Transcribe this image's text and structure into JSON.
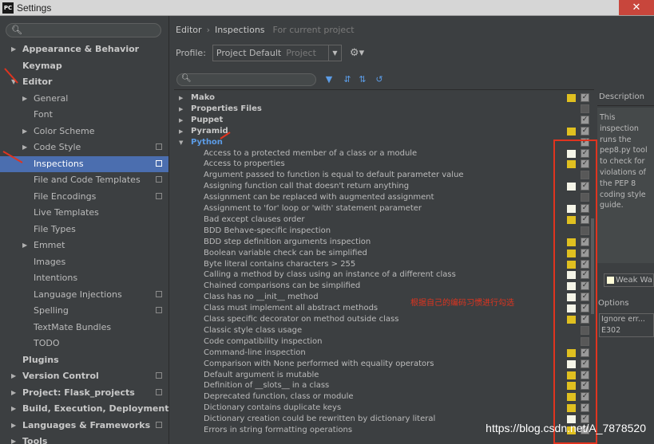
{
  "window": {
    "title": "Settings",
    "app_icon": "PC",
    "close_glyph": "✕"
  },
  "sidebar": {
    "search_placeholder": "",
    "items": [
      {
        "label": "Appearance & Behavior",
        "level": 0,
        "arrow": "▶",
        "bold": true
      },
      {
        "label": "Keymap",
        "level": 0,
        "arrow": "",
        "bold": true
      },
      {
        "label": "Editor",
        "level": 0,
        "arrow": "▼",
        "bold": true
      },
      {
        "label": "General",
        "level": 1,
        "arrow": "▶"
      },
      {
        "label": "Font",
        "level": 1,
        "arrow": ""
      },
      {
        "label": "Color Scheme",
        "level": 1,
        "arrow": "▶"
      },
      {
        "label": "Code Style",
        "level": 1,
        "arrow": "▶",
        "pin": true
      },
      {
        "label": "Inspections",
        "level": 1,
        "arrow": "",
        "pin": true,
        "selected": true
      },
      {
        "label": "File and Code Templates",
        "level": 1,
        "arrow": "",
        "pin": true
      },
      {
        "label": "File Encodings",
        "level": 1,
        "arrow": "",
        "pin": true
      },
      {
        "label": "Live Templates",
        "level": 1,
        "arrow": ""
      },
      {
        "label": "File Types",
        "level": 1,
        "arrow": ""
      },
      {
        "label": "Emmet",
        "level": 1,
        "arrow": "▶"
      },
      {
        "label": "Images",
        "level": 1,
        "arrow": ""
      },
      {
        "label": "Intentions",
        "level": 1,
        "arrow": ""
      },
      {
        "label": "Language Injections",
        "level": 1,
        "arrow": "",
        "pin": true
      },
      {
        "label": "Spelling",
        "level": 1,
        "arrow": "",
        "pin": true
      },
      {
        "label": "TextMate Bundles",
        "level": 1,
        "arrow": ""
      },
      {
        "label": "TODO",
        "level": 1,
        "arrow": ""
      },
      {
        "label": "Plugins",
        "level": 0,
        "arrow": "",
        "bold": true
      },
      {
        "label": "Version Control",
        "level": 0,
        "arrow": "▶",
        "bold": true,
        "pin": true
      },
      {
        "label": "Project: Flask_projects",
        "level": 0,
        "arrow": "▶",
        "bold": true,
        "pin": true
      },
      {
        "label": "Build, Execution, Deployment",
        "level": 0,
        "arrow": "▶",
        "bold": true
      },
      {
        "label": "Languages & Frameworks",
        "level": 0,
        "arrow": "▶",
        "bold": true,
        "pin": true
      },
      {
        "label": "Tools",
        "level": 0,
        "arrow": "▶",
        "bold": true
      }
    ]
  },
  "breadcrumb": {
    "part1": "Editor",
    "sep": "›",
    "part2": "Inspections",
    "note": "For current project"
  },
  "profile": {
    "label": "Profile:",
    "value": "Project Default",
    "scope": "Project",
    "dropdown_glyph": "▼",
    "gear_glyph": "⚙▾"
  },
  "inspections": {
    "groups_before": [
      {
        "label": "Mako",
        "sev": "#e0c020",
        "checked": true
      },
      {
        "label": "Properties Files",
        "sev": "",
        "checked": false
      },
      {
        "label": "Puppet",
        "sev": "",
        "checked": true
      },
      {
        "label": "Pyramid",
        "sev": "#e0c020",
        "checked": true
      }
    ],
    "python_label": "Python",
    "python_items": [
      {
        "label": "Access to a protected member of a class or a module",
        "sev": "#f5f5e8",
        "checked": true
      },
      {
        "label": "Access to properties",
        "sev": "#e0c020",
        "checked": true
      },
      {
        "label": "Argument passed to function is equal to default parameter value",
        "sev": "",
        "checked": false
      },
      {
        "label": "Assigning function call that doesn't return anything",
        "sev": "#f5f5e8",
        "checked": true
      },
      {
        "label": "Assignment can be replaced with augmented assignment",
        "sev": "",
        "checked": false
      },
      {
        "label": "Assignment to 'for' loop or 'with' statement parameter",
        "sev": "#f5f5e8",
        "checked": true
      },
      {
        "label": "Bad except clauses order",
        "sev": "#e0c020",
        "checked": true
      },
      {
        "label": "BDD Behave-specific inspection",
        "sev": "",
        "checked": false
      },
      {
        "label": "BDD step definition arguments inspection",
        "sev": "#e0c020",
        "checked": true
      },
      {
        "label": "Boolean variable check can be simplified",
        "sev": "#e0c020",
        "checked": true
      },
      {
        "label": "Byte literal contains characters > 255",
        "sev": "#e0c020",
        "checked": true
      },
      {
        "label": "Calling a method by class using an instance of a different class",
        "sev": "#f5f5e8",
        "checked": true
      },
      {
        "label": "Chained comparisons can be simplified",
        "sev": "#f5f5e8",
        "checked": true
      },
      {
        "label": "Class has no __init__ method",
        "sev": "#f5f5e8",
        "checked": true
      },
      {
        "label": "Class must implement all abstract methods",
        "sev": "#f5f5e8",
        "checked": true
      },
      {
        "label": "Class specific decorator on method outside class",
        "sev": "#e0c020",
        "checked": true
      },
      {
        "label": "Classic style class usage",
        "sev": "",
        "checked": false
      },
      {
        "label": "Code compatibility inspection",
        "sev": "",
        "checked": false
      },
      {
        "label": "Command-line inspection",
        "sev": "#e0c020",
        "checked": true
      },
      {
        "label": "Comparison with None performed with equality operators",
        "sev": "#f5f5e8",
        "checked": true
      },
      {
        "label": "Default argument is mutable",
        "sev": "#e0c020",
        "checked": true
      },
      {
        "label": "Definition of __slots__ in a class",
        "sev": "#e0c020",
        "checked": true
      },
      {
        "label": "Deprecated function, class or module",
        "sev": "#e0c020",
        "checked": true
      },
      {
        "label": "Dictionary contains duplicate keys",
        "sev": "#e0c020",
        "checked": true
      },
      {
        "label": "Dictionary creation could be rewritten by dictionary literal",
        "sev": "#f5f5e8",
        "checked": true
      },
      {
        "label": "Errors in string formatting operations",
        "sev": "#e0c020",
        "checked": true
      }
    ]
  },
  "description": {
    "header": "Description",
    "lines": [
      "This",
      "inspection",
      "runs the",
      "pep8.py tool",
      "to check for",
      "violations of",
      "the PEP 8",
      "coding style",
      "guide."
    ],
    "severity_value": "Weak Wa",
    "options_label": "Options",
    "options": [
      "Ignore err...",
      "E302"
    ]
  },
  "annotation": {
    "text": "根据自己的编码习惯进行勾选",
    "color": "#e0341f"
  },
  "watermark": "https://blog.csdn.net/A_7878520"
}
